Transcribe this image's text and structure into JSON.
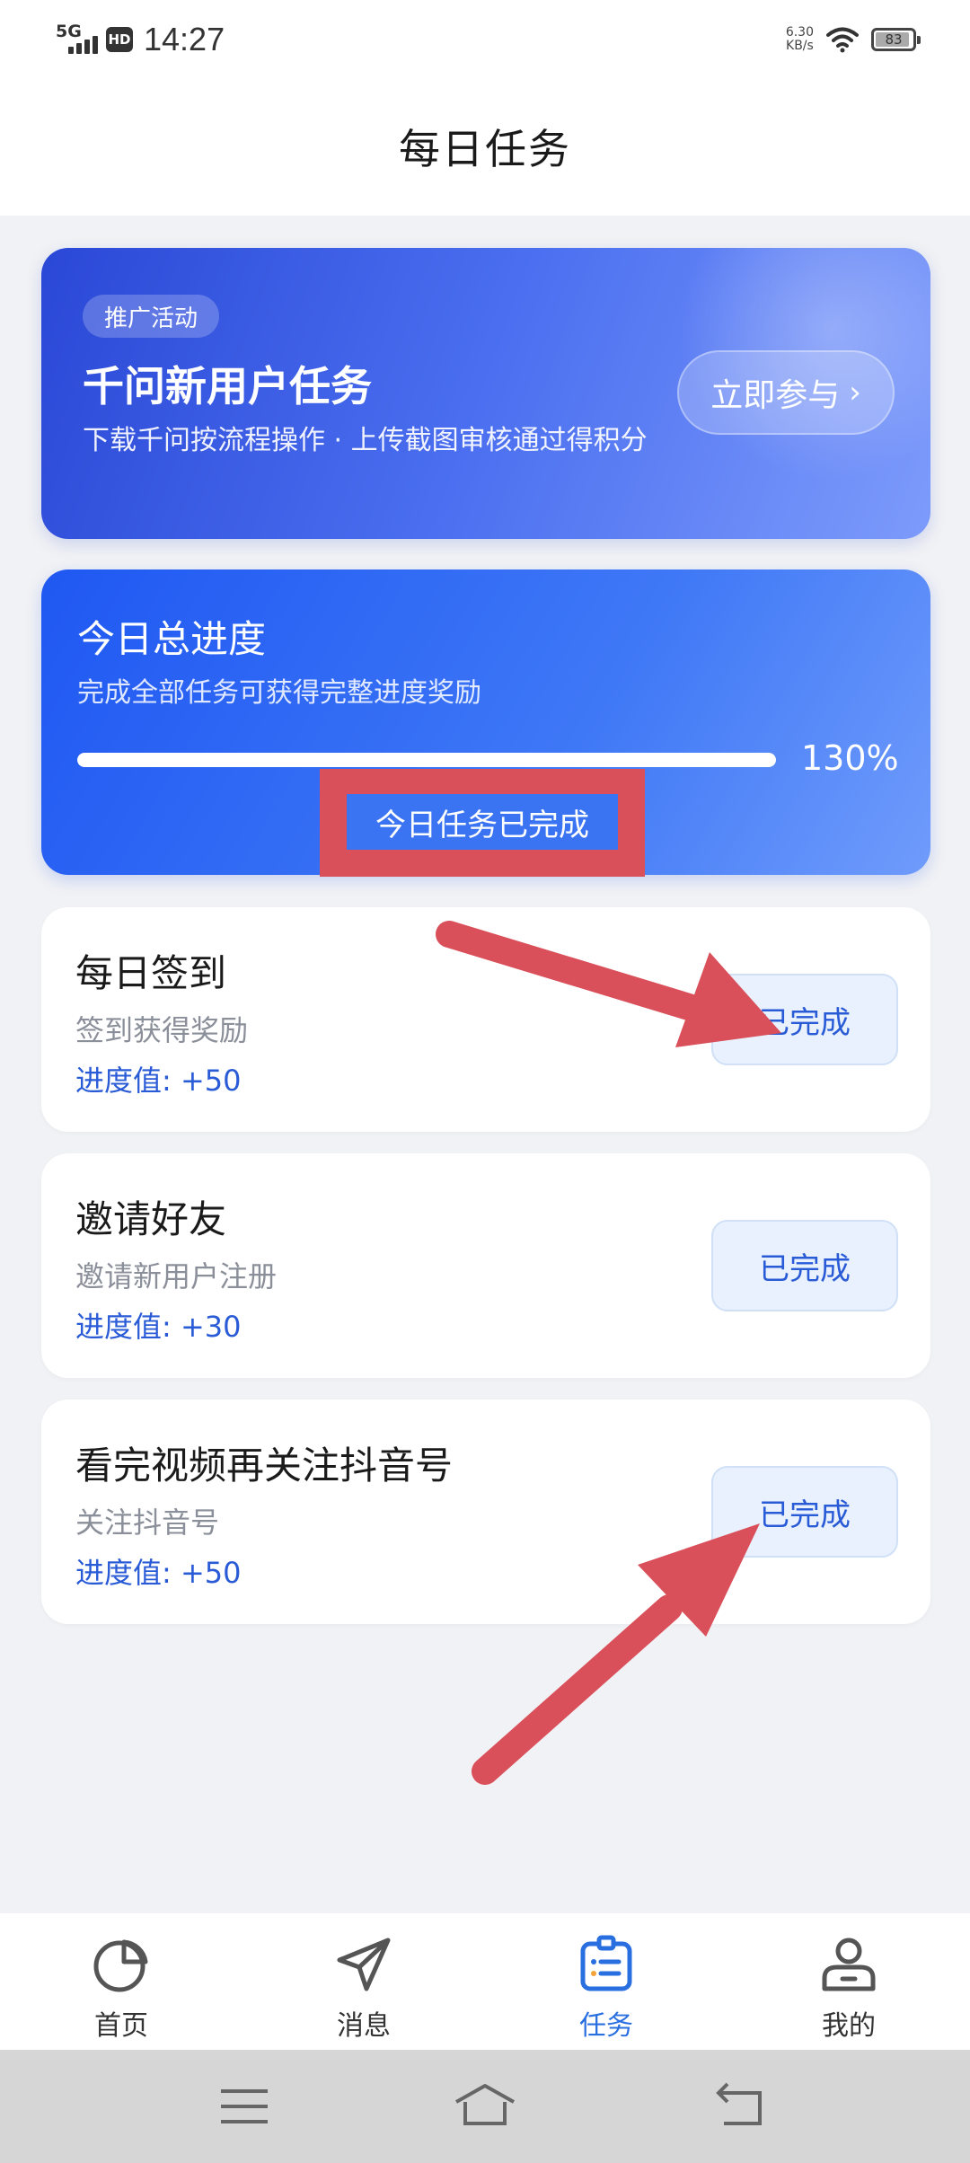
{
  "status_bar": {
    "network": "5G",
    "hd": "HD",
    "time": "14:27",
    "speed_value": "6.30",
    "speed_unit": "KB/s",
    "battery": "83"
  },
  "header": {
    "title": "每日任务"
  },
  "promo": {
    "tag": "推广活动",
    "title": "千问新用户任务",
    "desc": "下载千问按流程操作 · 上传截图审核通过得积分",
    "button_label": "立即参与",
    "button_chevron": "›"
  },
  "progress": {
    "title": "今日总进度",
    "subtitle": "完成全部任务可获得完整进度奖励",
    "percent_label": "130%",
    "fill_fraction": 1.0,
    "status": "今日任务已完成"
  },
  "tasks": [
    {
      "title": "每日签到",
      "desc": "签到获得奖励",
      "progress": "进度值: +50",
      "button": "已完成"
    },
    {
      "title": "邀请好友",
      "desc": "邀请新用户注册",
      "progress": "进度值: +30",
      "button": "已完成"
    },
    {
      "title": "看完视频再关注抖音号",
      "desc": "关注抖音号",
      "progress": "进度值: +50",
      "button": "已完成"
    }
  ],
  "bottom_nav": {
    "items": [
      {
        "label": "首页",
        "icon": "pie-chart-icon"
      },
      {
        "label": "消息",
        "icon": "send-icon"
      },
      {
        "label": "任务",
        "icon": "task-list-icon",
        "active": true
      },
      {
        "label": "我的",
        "icon": "user-icon"
      }
    ]
  },
  "colors": {
    "accent": "#2a6fe0",
    "annotation": "#d9505a",
    "completed_btn_bg": "#e8f1fd"
  }
}
